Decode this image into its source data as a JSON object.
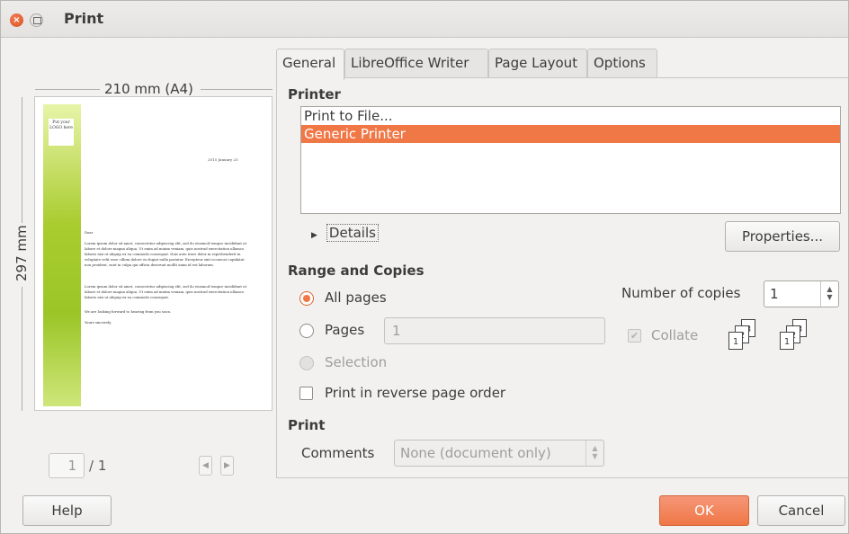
{
  "window": {
    "title": "Print"
  },
  "preview": {
    "width_label": "210 mm (A4)",
    "height_label": "297 mm",
    "page_number": "1",
    "page_total": "/ 1",
    "doc": {
      "logo_text": "Put your LOGO here",
      "date": "2015 January 25",
      "salutation": "Dear",
      "para1": "Lorem ipsum dolor sit amet, consectetur adipiscing elit, sed do eiusmod tempor incididunt ut labore et dolore magna aliqua. Ut enim ad minim veniam, quis nostrud exercitation ullamco laboris nisi ut aliquip ex ea commodo consequat. Duis aute irure dolor in reprehenderit in voluptate velit esse cillum dolore eu fugiat nulla pariatur. Excepteur sint occaecat cupidatat non proident, sunt in culpa qui officia deserunt mollit anim id est laborum.",
      "para2": "Lorem ipsum dolor sit amet, consectetur adipiscing elit, sed do eiusmod tempor incididunt ut labore et dolore magna aliqua. Ut enim ad minim veniam, quis nostrud exercitation ullamco laboris nisi ut aliquip ex ea commodo consequat.",
      "closing1": "We are looking forward to hearing from you soon.",
      "closing2": "Yours sincerely,"
    }
  },
  "tabs": [
    {
      "label": "General"
    },
    {
      "label": "LibreOffice Writer"
    },
    {
      "label": "Page Layout"
    },
    {
      "label": "Options"
    }
  ],
  "printer": {
    "section": "Printer",
    "items": [
      "Print to File...",
      "Generic Printer"
    ],
    "details": "Details",
    "properties": "Properties..."
  },
  "range": {
    "section": "Range and Copies",
    "all_pages": "All pages",
    "pages": "Pages",
    "pages_value": "1",
    "selection": "Selection",
    "reverse": "Print in reverse page order",
    "copies_label": "Number of copies",
    "copies_value": "1",
    "collate": "Collate"
  },
  "print": {
    "section": "Print",
    "comments_label": "Comments",
    "comments_value": "None (document only)"
  },
  "buttons": {
    "help": "Help",
    "ok": "OK",
    "cancel": "Cancel"
  }
}
